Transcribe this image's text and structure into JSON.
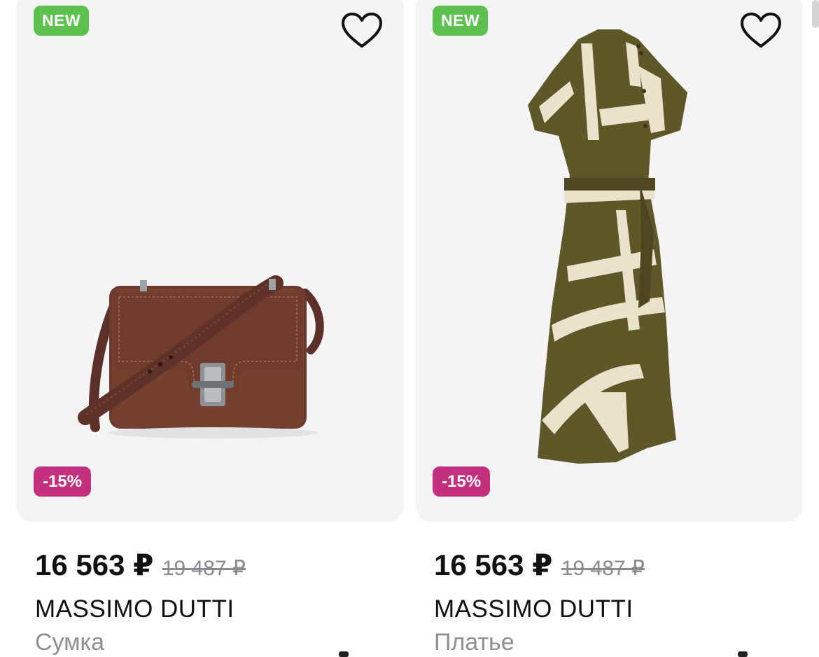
{
  "products": [
    {
      "badge_new": "NEW",
      "discount": "-15%",
      "price": "16 563 ₽",
      "old_price": "19 487 ₽",
      "brand": "MASSIMO DUTTI",
      "category": "Сумка",
      "image": "brown-leather-crossbody-bag",
      "favorite_icon": "heart-outline-icon"
    },
    {
      "badge_new": "NEW",
      "discount": "-15%",
      "price": "16 563 ₽",
      "old_price": "19 487 ₽",
      "brand": "MASSIMO DUTTI",
      "category": "Платье",
      "image": "olive-cream-print-wrap-dress",
      "favorite_icon": "heart-outline-icon"
    }
  ],
  "colors": {
    "badge_new_bg": "#5cc14f",
    "badge_sale_bg": "#c2307e",
    "card_bg": "#f4f4f5",
    "text_primary": "#111111",
    "text_secondary": "#8e8e93"
  }
}
